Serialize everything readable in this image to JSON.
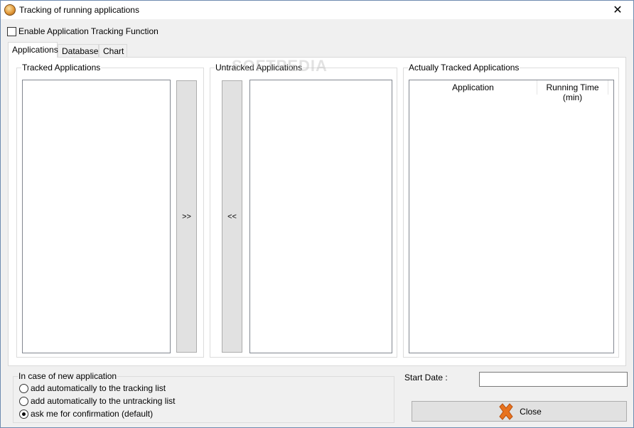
{
  "window": {
    "title": "Tracking of running applications"
  },
  "enable_tracking": {
    "label": "Enable Application Tracking Function",
    "checked": false
  },
  "tabs": [
    {
      "label": "Applications",
      "active": true
    },
    {
      "label": "Database",
      "active": false
    },
    {
      "label": "Chart",
      "active": false
    }
  ],
  "tracked": {
    "label": "Tracked Applications",
    "items": []
  },
  "untracked": {
    "label": "Untracked Applications",
    "items": []
  },
  "move_buttons": {
    "to_untracked": ">>",
    "to_tracked": "<<"
  },
  "actually_tracked": {
    "label": "Actually Tracked Applications",
    "columns": [
      "Application",
      "Running Time (min)"
    ],
    "rows": []
  },
  "watermark": "SOFTPEDIA",
  "new_application": {
    "label": "In case of new application",
    "options": [
      {
        "label": "add automatically to the tracking list",
        "selected": false
      },
      {
        "label": "add automatically to the untracking list",
        "selected": false
      },
      {
        "label": "ask me for confirmation (default)",
        "selected": true
      }
    ]
  },
  "start_date": {
    "label": "Start Date :",
    "value": ""
  },
  "close_button": {
    "label": "Close",
    "icon_color": "#e8731f"
  }
}
